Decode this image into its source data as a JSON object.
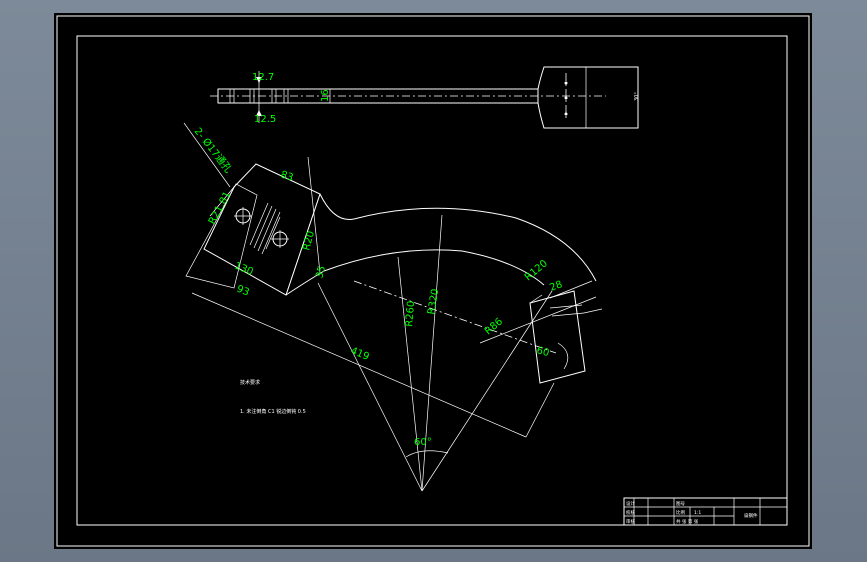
{
  "top_view": {
    "dims": [
      "12.7",
      "12.5",
      "16"
    ],
    "end_label": "30°"
  },
  "main_view": {
    "hole_note": "2- Ø17通孔",
    "dims": [
      "83",
      "R21.81",
      "130",
      "93",
      "R20",
      "35",
      "R260",
      "R320",
      "R120",
      "28",
      "R86",
      "60",
      "419",
      "60°"
    ]
  },
  "notes": {
    "title": "技术要求",
    "line1": "1. 未注倒角 C1  锐边倒钝 0.5"
  },
  "title_block": {
    "cell_a": "设计",
    "cell_b": "校核",
    "cell_c": "审核",
    "cell_d": "比例",
    "cell_e": "1:1",
    "cell_f": "图号",
    "cell_g": "共  张  第  张",
    "cell_h": "扁钢件"
  },
  "colors": {
    "background": "#000000",
    "lines": "#ffffff",
    "dimensions": "#00ff00",
    "frame": "#7d8a99"
  }
}
